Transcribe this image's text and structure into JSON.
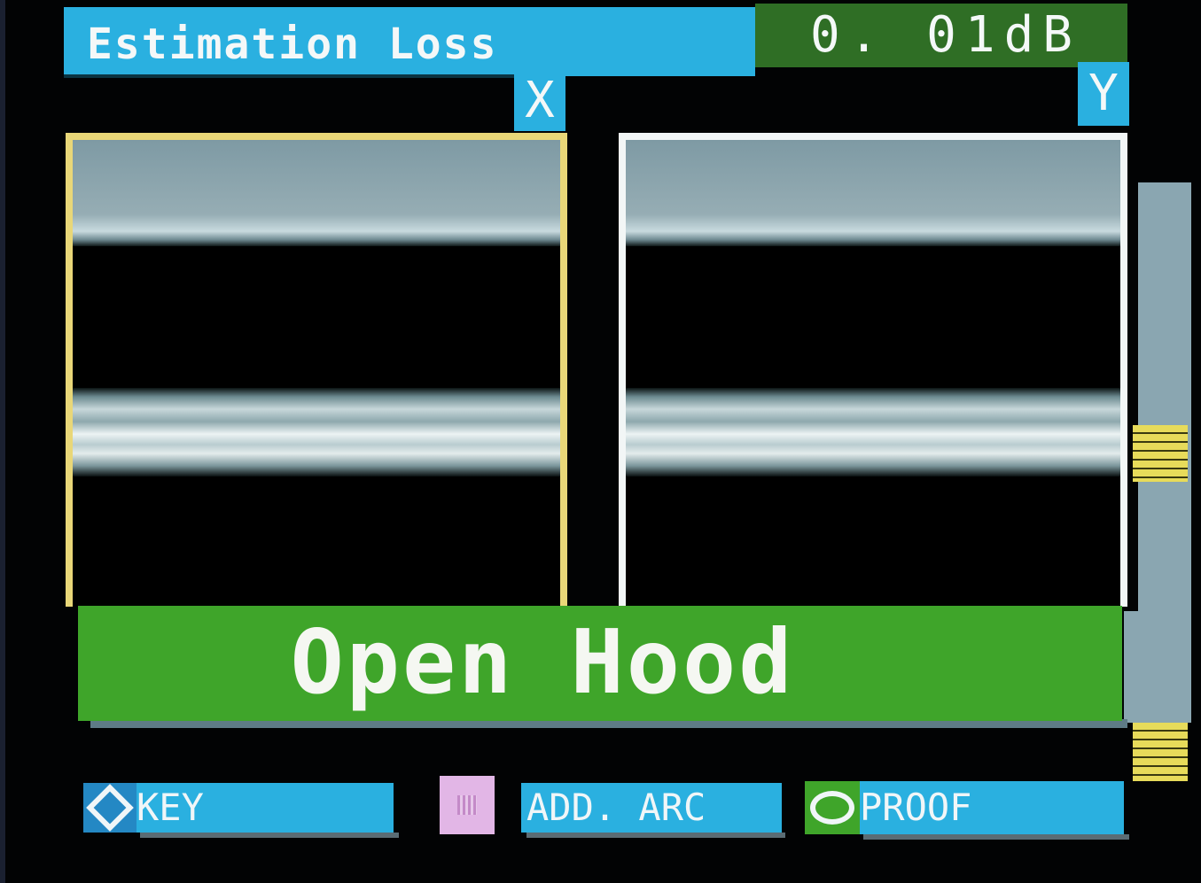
{
  "header": {
    "title": "Estimation Loss",
    "loss_value": "0. 01dB"
  },
  "views": {
    "x_label": "X",
    "y_label": "Y"
  },
  "banner": {
    "message": "Open Hood"
  },
  "footer": {
    "key_label": "KEY",
    "add_arc_label": "ADD. ARC",
    "proof_label": "PROOF"
  },
  "colors": {
    "title_bar": "#2ab0e0",
    "loss_bar": "#2f6e25",
    "banner": "#3fa52a",
    "x_frame": "#e9d778",
    "y_frame": "#f2f6f6",
    "scroll_thumb": "#e7db5a"
  },
  "icons": {
    "key": "diamond-icon",
    "add_arc": "square-icon",
    "proof": "circle-icon"
  }
}
